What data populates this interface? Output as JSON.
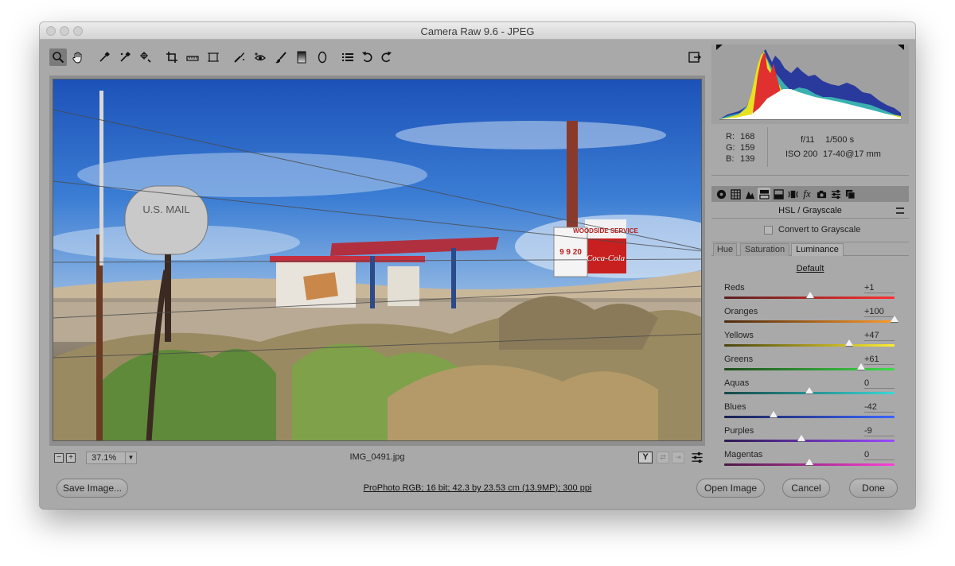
{
  "window": {
    "title": "Camera Raw 9.6  -  JPEG"
  },
  "toolbar": {
    "tools": [
      {
        "name": "zoom-tool",
        "icon": "zoom-icon",
        "active": true
      },
      {
        "name": "hand-tool",
        "icon": "hand-icon",
        "active": false
      },
      {
        "name": "white-balance-tool",
        "icon": "eyedropper-icon",
        "active": false
      },
      {
        "name": "color-sampler-tool",
        "icon": "color-sampler-icon",
        "active": false
      },
      {
        "name": "targeted-adjustment-tool",
        "icon": "target-adjust-icon",
        "active": false
      },
      {
        "name": "crop-tool",
        "icon": "crop-icon",
        "active": false
      },
      {
        "name": "straighten-tool",
        "icon": "straighten-icon",
        "active": false
      },
      {
        "name": "transform-tool",
        "icon": "transform-icon",
        "active": false
      },
      {
        "name": "spot-removal-tool",
        "icon": "spot-removal-icon",
        "active": false
      },
      {
        "name": "red-eye-tool",
        "icon": "red-eye-icon",
        "active": false
      },
      {
        "name": "adjustment-brush-tool",
        "icon": "brush-icon",
        "active": false
      },
      {
        "name": "graduated-filter-tool",
        "icon": "graduated-filter-icon",
        "active": false
      },
      {
        "name": "radial-filter-tool",
        "icon": "radial-filter-icon",
        "active": false
      },
      {
        "name": "preferences-tool",
        "icon": "list-icon",
        "active": false
      },
      {
        "name": "rotate-left-tool",
        "icon": "rotate-ccw-icon",
        "active": false
      },
      {
        "name": "rotate-right-tool",
        "icon": "rotate-cw-icon",
        "active": false
      }
    ]
  },
  "status": {
    "zoom_minus": "−",
    "zoom_plus": "+",
    "zoom": "37.1%",
    "filename": "IMG_0491.jpg"
  },
  "readout": {
    "r_label": "R:",
    "r": "168",
    "g_label": "G:",
    "g": "159",
    "b_label": "B:",
    "b": "139",
    "aperture": "f/11",
    "shutter": "1/500 s",
    "iso": "ISO 200",
    "lens": "17-40@17 mm"
  },
  "panel": {
    "title": "HSL / Grayscale",
    "convert_label": "Convert to Grayscale",
    "convert_checked": false,
    "subtabs": [
      "Hue",
      "Saturation",
      "Luminance"
    ],
    "active_subtab": "Luminance",
    "default_label": "Default",
    "sliders": [
      {
        "label": "Reds",
        "value": "+1",
        "level": 1,
        "colors": [
          "#5a2020",
          "#ff3030"
        ]
      },
      {
        "label": "Oranges",
        "value": "+100",
        "level": 100,
        "colors": [
          "#4a2a10",
          "#ff9a2a"
        ]
      },
      {
        "label": "Yellows",
        "value": "+47",
        "level": 47,
        "colors": [
          "#4a4410",
          "#ffee30"
        ]
      },
      {
        "label": "Greens",
        "value": "+61",
        "level": 61,
        "colors": [
          "#1e4a1e",
          "#3fdc4a"
        ]
      },
      {
        "label": "Aquas",
        "value": "0",
        "level": 0,
        "colors": [
          "#164646",
          "#3ad8d8"
        ]
      },
      {
        "label": "Blues",
        "value": "-42",
        "level": -42,
        "colors": [
          "#1a2250",
          "#3a64ff"
        ]
      },
      {
        "label": "Purples",
        "value": "-9",
        "level": -9,
        "colors": [
          "#2e1a50",
          "#9a4aff"
        ]
      },
      {
        "label": "Magentas",
        "value": "0",
        "level": 0,
        "colors": [
          "#4a1a44",
          "#ff40d8"
        ]
      }
    ]
  },
  "bottom": {
    "save_label": "Save Image...",
    "workflow": "ProPhoto RGB; 16 bit; 42.3 by 23.53 cm (13.9MP); 300 ppi",
    "open_label": "Open Image",
    "cancel_label": "Cancel",
    "done_label": "Done"
  },
  "photo": {
    "mailbox_text": "U.S. MAIL",
    "sign_text": "WOODSIDE SERVICE",
    "cola_text": "Coca-Cola",
    "price_text": "9 9 20"
  }
}
